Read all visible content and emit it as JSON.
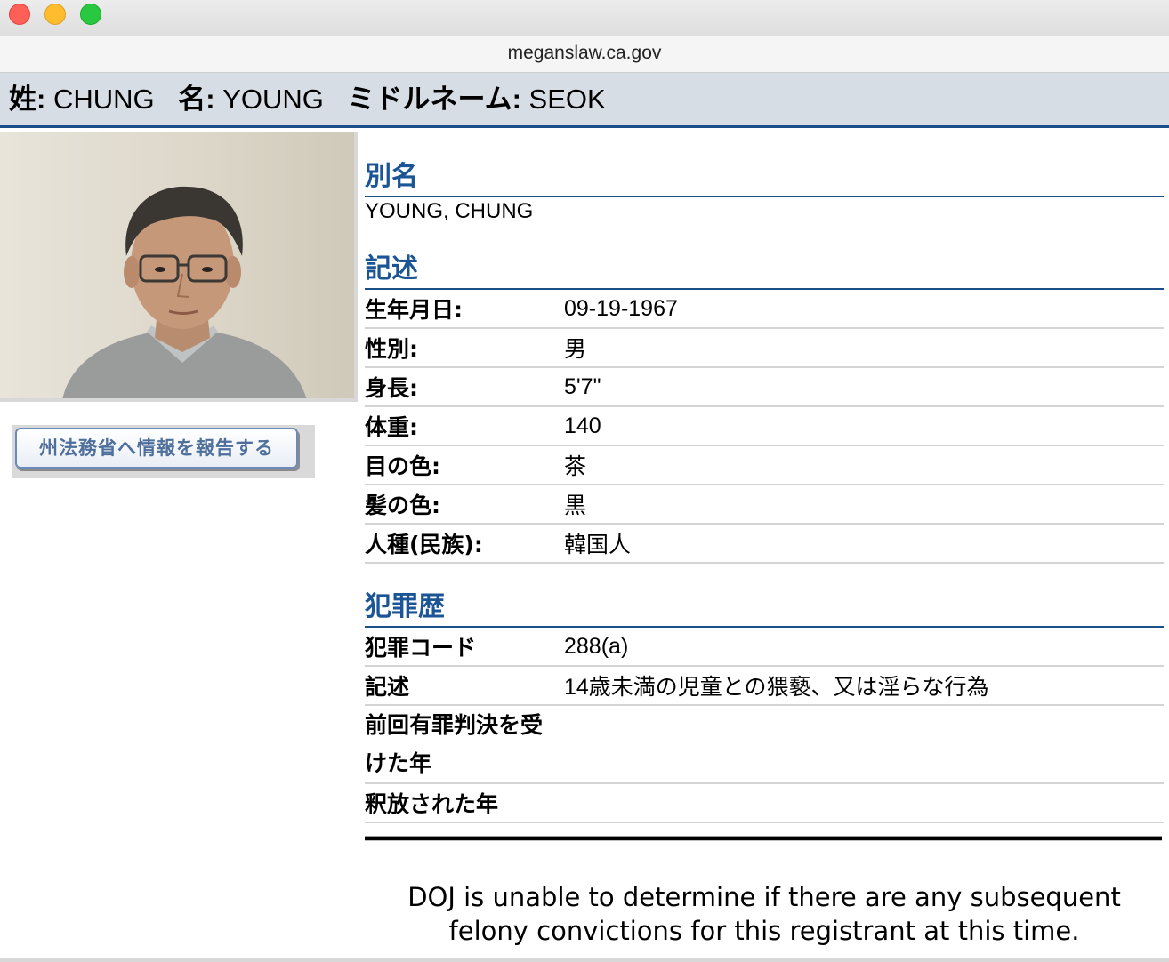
{
  "browser": {
    "url": "meganslaw.ca.gov"
  },
  "name_bar": {
    "last_label": "姓:",
    "last_value": "CHUNG",
    "first_label": "名:",
    "first_value": "YOUNG",
    "middle_label": "ミドルネーム:",
    "middle_value": "SEOK"
  },
  "report_button": {
    "label": "州法務省へ情報を報告する"
  },
  "alias_section": {
    "title": "別名",
    "value": "YOUNG, CHUNG"
  },
  "description_section": {
    "title": "記述",
    "rows": [
      {
        "label": "生年月日:",
        "value": "09-19-1967"
      },
      {
        "label": "性別:",
        "value": "男"
      },
      {
        "label": "身長:",
        "value": "5'7\""
      },
      {
        "label": "体重:",
        "value": "140"
      },
      {
        "label": "目の色:",
        "value": "茶"
      },
      {
        "label": "髪の色:",
        "value": "黒"
      },
      {
        "label": "人種(民族):",
        "value": "韓国人"
      }
    ]
  },
  "crime_section": {
    "title": "犯罪歴",
    "rows": [
      {
        "label": "犯罪コード",
        "value": "288(a)"
      },
      {
        "label": "記述",
        "value": "14歳未満の児童との猥褻、又は淫らな行為"
      },
      {
        "label": "前回有罪判決を受けた年",
        "value": ""
      },
      {
        "label": "釈放された年",
        "value": ""
      }
    ]
  },
  "notice": "DOJ is unable to determine if there are any subsequent felony convictions for this registrant at this time.",
  "colors": {
    "section_title": "#1b5596",
    "name_bar_bg": "#d6dde5",
    "accent_rule": "#1b4f8a"
  }
}
